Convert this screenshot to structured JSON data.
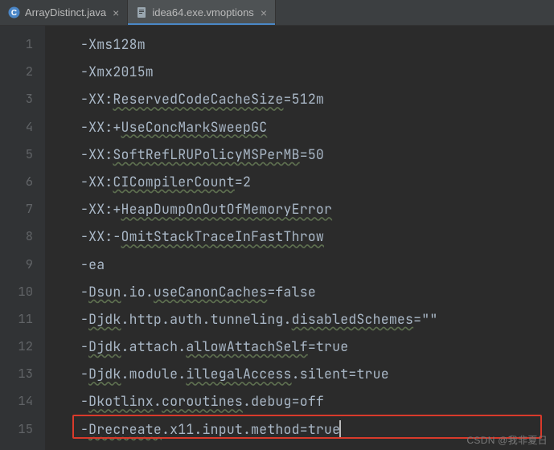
{
  "tabs": [
    {
      "label": "ArrayDistinct.java",
      "active": false,
      "icon": "java"
    },
    {
      "label": "idea64.exe.vmoptions",
      "active": true,
      "icon": "file"
    }
  ],
  "gutter": [
    "1",
    "2",
    "3",
    "4",
    "5",
    "6",
    "7",
    "8",
    "9",
    "10",
    "11",
    "12",
    "13",
    "14",
    "15"
  ],
  "lines": {
    "l1": "-Xms128m",
    "l2": "-Xmx2015m",
    "l3a": "-XX:",
    "l3b": "ReservedCodeCacheSize",
    "l3c": "=512m",
    "l4a": "-XX:+",
    "l4b": "UseConcMarkSweepGC",
    "l5a": "-XX:",
    "l5b": "SoftRefLRUPolicyMSPerMB",
    "l5c": "=50",
    "l6a": "-XX:",
    "l6b": "CICompilerCount",
    "l6c": "=2",
    "l7a": "-XX:+",
    "l7b": "HeapDumpOnOutOfMemoryError",
    "l8a": "-XX:-",
    "l8b": "OmitStackTraceInFastThrow",
    "l9": "-ea",
    "l10a": "-",
    "l10b": "Dsun",
    "l10c": ".io.",
    "l10d": "useCanonCaches",
    "l10e": "=false",
    "l11a": "-",
    "l11b": "Djdk",
    "l11c": ".http.auth.tunneling.",
    "l11d": "disabledSchemes",
    "l11e": "=\"\"",
    "l12a": "-",
    "l12b": "Djdk",
    "l12c": ".attach.",
    "l12d": "allowAttachSelf",
    "l12e": "=true",
    "l13a": "-",
    "l13b": "Djdk",
    "l13c": ".module.",
    "l13d": "illegalAccess",
    "l13e": ".silent=true",
    "l14a": "-",
    "l14b": "Dkotlinx",
    "l14c": ".",
    "l14d": "coroutines",
    "l14e": ".debug=off",
    "l15a": "-",
    "l15b": "Drecreate",
    "l15c": ".x11.input.method=true"
  },
  "watermark": "CSDN @我非夏日"
}
